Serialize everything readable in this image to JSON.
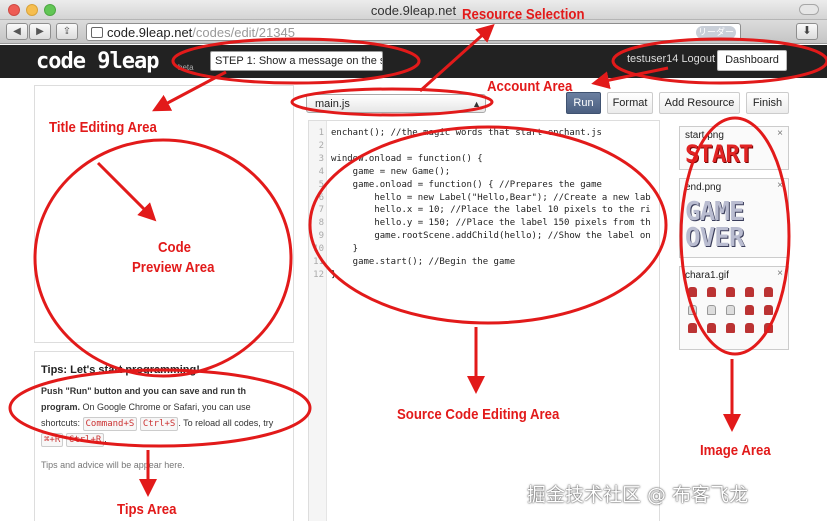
{
  "window": {
    "title": "code.9leap.net"
  },
  "browser": {
    "back": "◀",
    "forward": "▶",
    "share": "⇪",
    "url_host": "code.9leap.net",
    "url_path": "/codes/edit/21345",
    "reader": "リーダー",
    "download": "⬇"
  },
  "app": {
    "logo": "code 9leap",
    "beta": "beta",
    "title_value": "STEP 1: Show a message on the sc",
    "user": "testuser14",
    "logout": "Logout",
    "dashboard": "Dashboard"
  },
  "editor": {
    "file": "main.js",
    "buttons": {
      "run": "Run",
      "format": "Format",
      "add_resource": "Add Resource",
      "finish": "Finish"
    },
    "line_numbers": [
      "1",
      "2",
      "3",
      "4",
      "5",
      "6",
      "7",
      "8",
      "9",
      "10",
      "11",
      "12"
    ],
    "lines": [
      "enchant(); //the magic words that start enchant.js",
      "",
      "window.onload = function() {",
      "    game = new Game();",
      "    game.onload = function() { //Prepares the game",
      "        hello = new Label(\"Hello,Bear\"); //Create a new lab",
      "        hello.x = 10; //Place the label 10 pixels to the ri",
      "        hello.y = 150; //Place the label 150 pixels from th",
      "        game.rootScene.addChild(hello); //Show the label on",
      "    }",
      "    game.start(); //Begin the game",
      "}"
    ]
  },
  "tips": {
    "heading": "Tips: Let's start programming!",
    "text1_bold": "Push \"Run\" button and you can save and run th program.",
    "text1_rest": " On Google Chrome or Safari, you can use shortcuts: ",
    "kbd1": "Command+S",
    "kbd2": "Ctrl+S",
    "text2": ". To reload all codes, try ",
    "kbd3": "⌘+R",
    "kbd4": "Ctrl+R",
    "text3": ".",
    "advice": "Tips and advice will be appear here."
  },
  "images": [
    {
      "name": "start.png",
      "close": "×",
      "art": "START"
    },
    {
      "name": "end.png",
      "close": "×",
      "art1": "GAME",
      "art2": "OVER"
    },
    {
      "name": "chara1.gif",
      "close": "×"
    }
  ],
  "annotations": {
    "resource_selection": "Resource Selection",
    "account_area": "Account Area",
    "title_editing_area": "Title Editing Area",
    "code_preview_area_1": "Code",
    "code_preview_area_2": "Preview Area",
    "source_code_editing_area": "Source Code Editing Area",
    "image_area": "Image Area",
    "tips_area": "Tips Area"
  },
  "watermark": "掘金技术社区 @ 布客飞龙",
  "colors": {
    "annotation": "#e21a1a",
    "run_button": "#4b5f80",
    "app_header": "#222222"
  }
}
